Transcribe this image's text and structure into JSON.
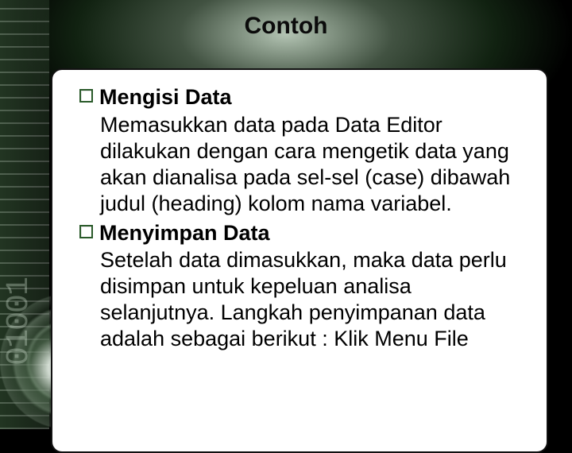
{
  "slide": {
    "title": "Contoh",
    "side_text": "01001",
    "items": [
      {
        "heading": "Mengisi Data",
        "body": "Memasukkan data pada Data Editor dilakukan dengan cara mengetik data yang akan dianalisa pada sel-sel (case) dibawah judul (heading) kolom nama variabel."
      },
      {
        "heading": "Menyimpan Data",
        "body": "Setelah data dimasukkan, maka data perlu disimpan untuk kepeluan analisa selanjutnya. Langkah penyimpanan data adalah sebagai berikut : Klik Menu File"
      }
    ]
  }
}
